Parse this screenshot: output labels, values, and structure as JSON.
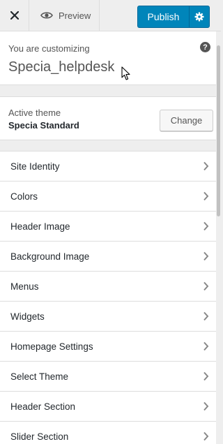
{
  "header": {
    "close_glyph": "✕",
    "preview_label": "Preview",
    "publish_label": "Publish"
  },
  "info": {
    "subtitle": "You are customizing",
    "site_name": "Specia_helpdesk",
    "help_glyph": "?"
  },
  "theme": {
    "label": "Active theme",
    "name": "Specia Standard",
    "change_label": "Change"
  },
  "menu": [
    {
      "label": "Site Identity"
    },
    {
      "label": "Colors"
    },
    {
      "label": "Header Image"
    },
    {
      "label": "Background Image"
    },
    {
      "label": "Menus"
    },
    {
      "label": "Widgets"
    },
    {
      "label": "Homepage Settings"
    },
    {
      "label": "Select Theme"
    },
    {
      "label": "Header Section"
    },
    {
      "label": "Slider Section"
    }
  ],
  "colors": {
    "accent": "#0085ba",
    "panel_bg": "#eeeeee"
  },
  "icons": {
    "close": "close-icon",
    "preview": "eye-icon",
    "settings": "gear-icon",
    "help": "help-icon",
    "chevron": "chevron-right-icon"
  }
}
